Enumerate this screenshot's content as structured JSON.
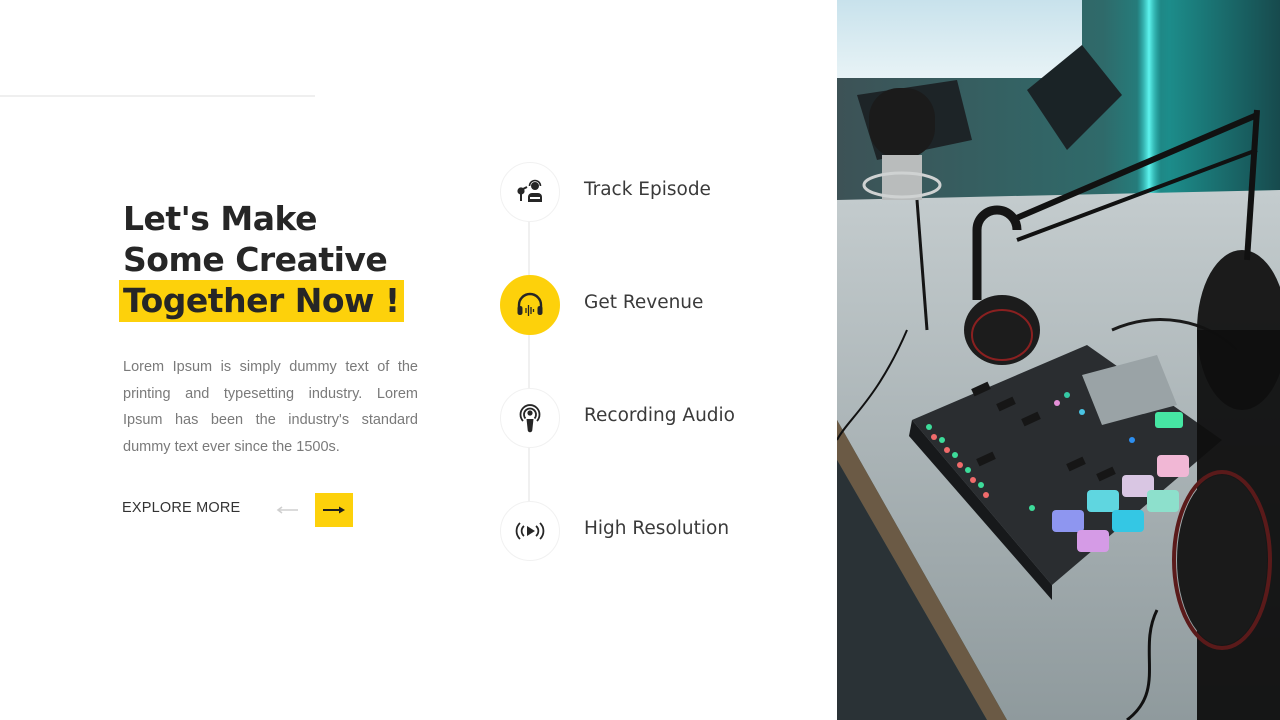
{
  "hero": {
    "headline_line1": "Let's Make",
    "headline_line2": "Some Creative",
    "headline_highlight": "Together Now !",
    "body": "Lorem Ipsum is simply dummy text of the printing and typesetting industry. Lorem Ipsum has been the industry's standard dummy text ever since the 1500s.",
    "explore_label": "EXPLORE MORE"
  },
  "navigation": {
    "prev_icon": "arrow-left-icon",
    "next_icon": "arrow-right-icon"
  },
  "steps": [
    {
      "label": "Track Episode",
      "icon": "podcaster-mic-icon",
      "active": false
    },
    {
      "label": "Get Revenue",
      "icon": "headphones-icon",
      "active": true
    },
    {
      "label": "Recording Audio",
      "icon": "podcast-icon",
      "active": false
    },
    {
      "label": "High Resolution",
      "icon": "broadcast-play-icon",
      "active": false
    }
  ],
  "photo": {
    "description": "Podcast studio with microphone, headphones and mixing console"
  },
  "colors": {
    "accent": "#fdd10b",
    "heading": "#262626",
    "body_text": "#7a7a7a"
  }
}
